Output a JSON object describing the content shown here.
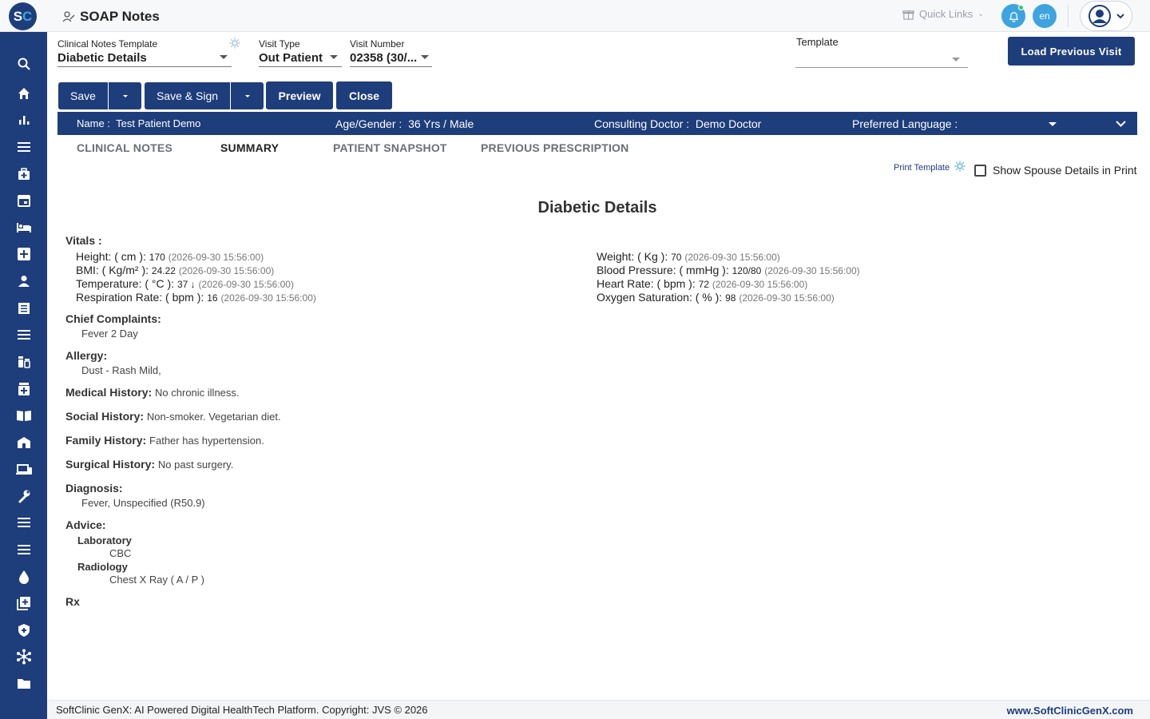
{
  "app": {
    "logo_s": "S",
    "logo_c": "C",
    "title": "SOAP Notes"
  },
  "topbar": {
    "quick_links": "Quick Links",
    "lang": "en"
  },
  "header": {
    "clinical_notes_template_label": "Clinical Notes Template",
    "clinical_notes_template_value": "Diabetic Details",
    "visit_type_label": "Visit Type",
    "visit_type_value": "Out Patient",
    "visit_number_label": "Visit Number",
    "visit_number_value": "02358 (30/...",
    "template_label": "Template",
    "template_value": "",
    "load_previous_visit": "Load Previous Visit"
  },
  "toolbar": {
    "save": "Save",
    "save_sign": "Save & Sign",
    "preview": "Preview",
    "close": "Close"
  },
  "patient": {
    "name_label": "Name :",
    "name": "Test Patient Demo",
    "age_gender_label": "Age/Gender :",
    "age_gender": "36 Yrs / Male",
    "doctor_label": "Consulting Doctor :",
    "doctor": "Demo Doctor",
    "pref_lang_label": "Preferred Language :"
  },
  "tabs": [
    "CLINICAL NOTES",
    "SUMMARY",
    "PATIENT SNAPSHOT",
    "PREVIOUS PRESCRIPTION"
  ],
  "print": {
    "print_template": "Print Template",
    "show_spouse": "Show Spouse Details in Print"
  },
  "summary": {
    "title": "Diabetic Details",
    "vitals_heading": "Vitals :",
    "vitals_left": [
      {
        "label": "Height: ( cm ):",
        "value": "170",
        "ts": "(2026-09-30 15:56:00)"
      },
      {
        "label": "BMI: ( Kg/m² ):",
        "value": "24.22",
        "ts": "(2026-09-30 15:56:00)"
      },
      {
        "label": "Temperature: ( °C ):",
        "value": "37 ↓",
        "ts": "(2026-09-30 15:56:00)"
      },
      {
        "label": "Respiration Rate: ( bpm ):",
        "value": "16",
        "ts": "(2026-09-30 15:56:00)"
      }
    ],
    "vitals_right": [
      {
        "label": "Weight: ( Kg ):",
        "value": "70",
        "ts": "(2026-09-30 15:56:00)"
      },
      {
        "label": "Blood Pressure: ( mmHg ):",
        "value": "120/80",
        "ts": "(2026-09-30 15:56:00)"
      },
      {
        "label": "Heart Rate: ( bpm ):",
        "value": "72",
        "ts": "(2026-09-30 15:56:00)"
      },
      {
        "label": "Oxygen Saturation: ( % ):",
        "value": "98",
        "ts": "(2026-09-30 15:56:00)"
      }
    ],
    "chief_complaints_heading": "Chief Complaints:",
    "chief_complaints": "Fever 2 Day",
    "allergy_heading": "Allergy:",
    "allergy": "Dust - Rash Mild,",
    "medical_history_heading": "Medical History:",
    "medical_history": "No chronic illness.",
    "social_history_heading": "Social History:",
    "social_history": "Non-smoker. Vegetarian diet.",
    "family_history_heading": "Family History:",
    "family_history": "Father has hypertension.",
    "surgical_history_heading": "Surgical History:",
    "surgical_history": "No past surgery.",
    "diagnosis_heading": "Diagnosis:",
    "diagnosis": "Fever, Unspecified (R50.9)",
    "advice_heading": "Advice:",
    "laboratory_heading": "Laboratory",
    "laboratory": "CBC",
    "radiology_heading": "Radiology",
    "radiology": "Chest X Ray ( A / P )",
    "rx_heading": "Rx"
  },
  "footer": {
    "left": "SoftClinic GenX: AI Powered Digital HealthTech Platform. Copyright: JVS © 2026",
    "right": "www.SoftClinicGenX.com"
  },
  "colors": {
    "primary": "#1e3d7b",
    "accent": "#3ea4e0",
    "online": "#34c759"
  },
  "sidebar_icons": [
    "search-icon",
    "home-icon",
    "bar-chart-icon",
    "menu-icon",
    "medical-bag-icon",
    "calendar-icon",
    "bed-icon",
    "medical-plus-icon",
    "user-icon",
    "document-icon",
    "menu-icon",
    "pharmacy-icon",
    "medicine-box-icon",
    "book-icon",
    "hospital-icon",
    "devices-icon",
    "wrench-icon",
    "menu-icon",
    "menu-icon",
    "blood-drop-icon",
    "add-box-icon",
    "shield-icon",
    "hub-icon",
    "folder-icon"
  ]
}
